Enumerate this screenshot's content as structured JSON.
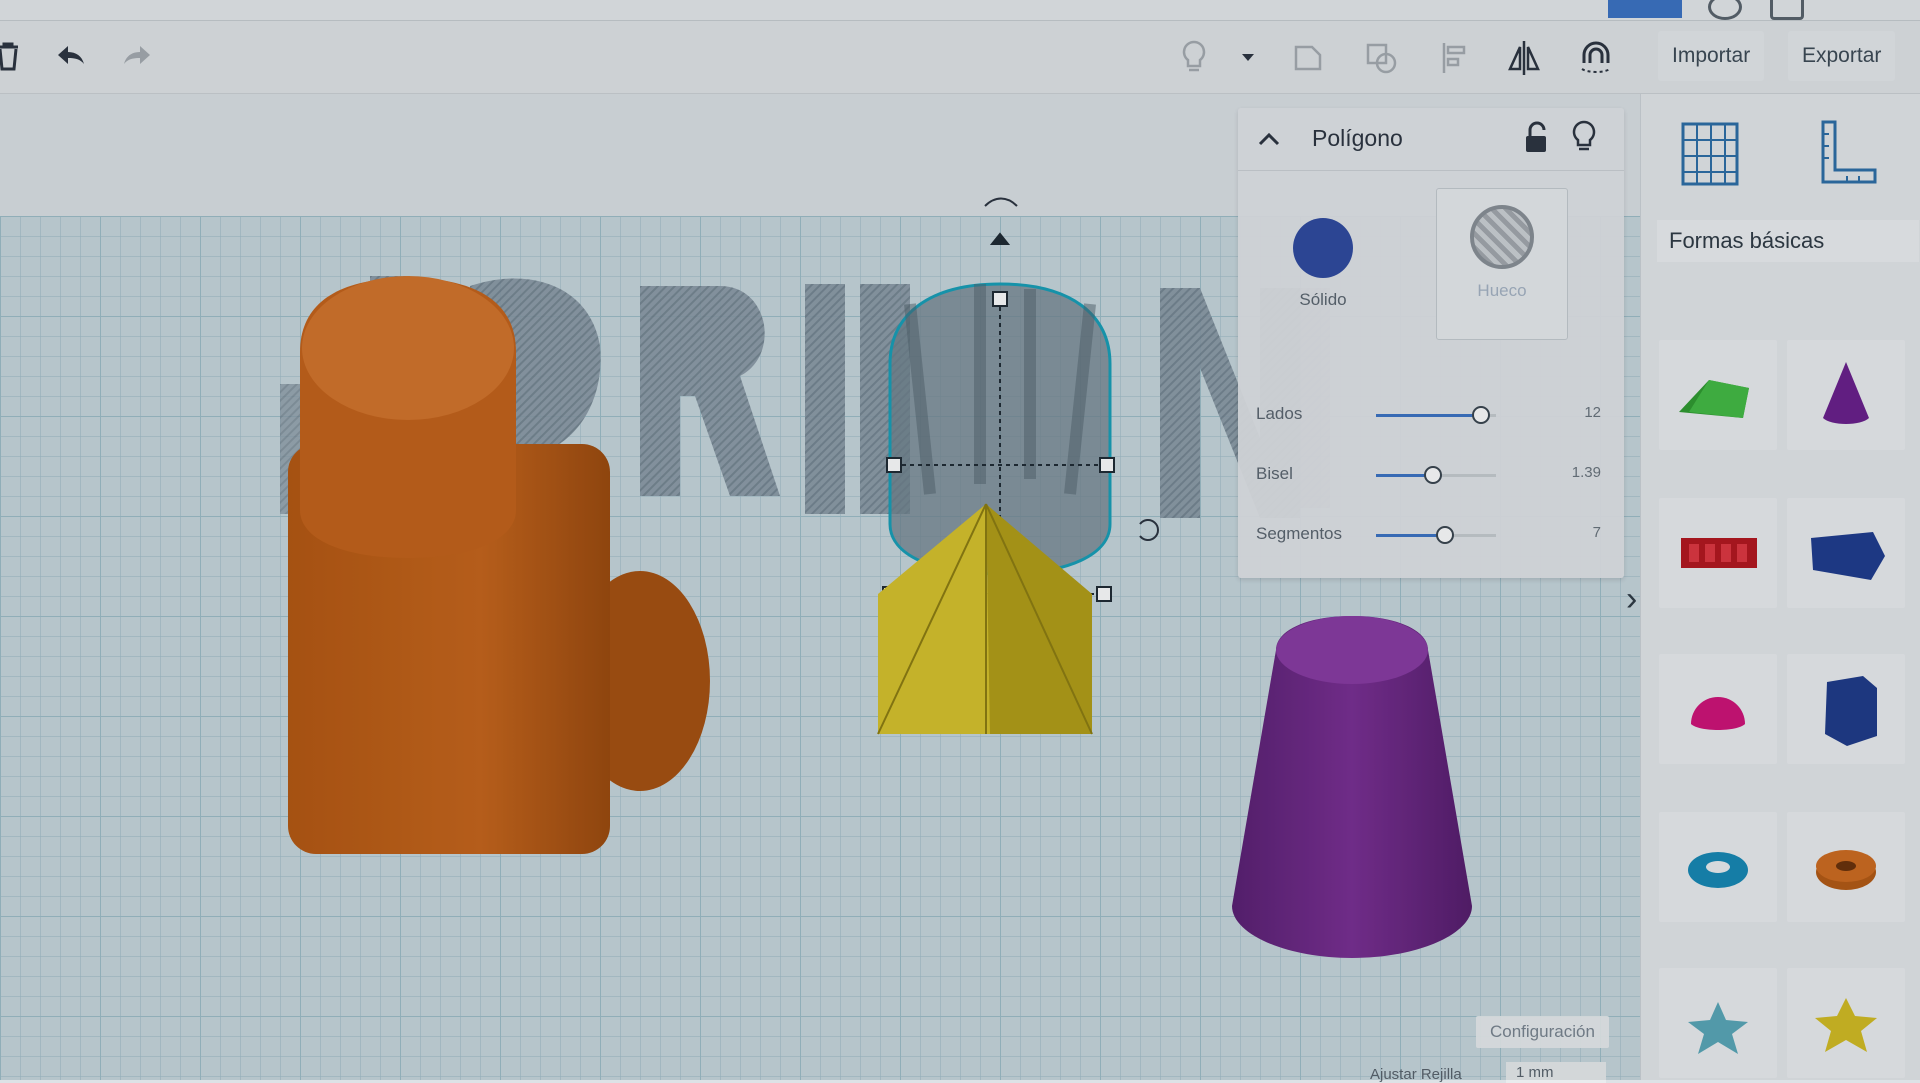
{
  "toolbar": {
    "import_label": "Importar",
    "export_label": "Exportar",
    "icons": [
      "delete-icon",
      "undo-icon",
      "redo-icon",
      "light-bulb-icon",
      "dropdown-caret-icon",
      "group-icon",
      "ungroup-icon",
      "align-icon",
      "mirror-icon",
      "magnet-icon"
    ]
  },
  "inspector": {
    "title": "Polígono",
    "solid_label": "Sólido",
    "hole_label": "Hueco",
    "solid_color": "#2f4aa0",
    "params": [
      {
        "label": "Lados",
        "value": "12",
        "fraction": 0.87
      },
      {
        "label": "Bisel",
        "value": "1.39",
        "fraction": 0.47
      },
      {
        "label": "Segmentos",
        "value": "7",
        "fraction": 0.57
      }
    ]
  },
  "library": {
    "title": "Formas básicas",
    "shapes": [
      "roof-shape-icon",
      "cone-shape-icon",
      "text-shape-icon",
      "wedge-shape-icon",
      "half-sphere-shape-icon",
      "polygon-shape-icon",
      "torus-shape-icon",
      "tube-shape-icon",
      "star-shape-icon",
      "yellow-star-shape-icon"
    ]
  },
  "workplane": {
    "settings_label": "Configuración",
    "snap_label": "Ajustar Rejilla",
    "snap_value": "1 mm",
    "text_object": "LORMAN"
  },
  "colors": {
    "accent": "#3b73c4",
    "orange_shape": "#c8651a",
    "yellow_shape": "#d4bd22",
    "purple_shape": "#6b2685",
    "hole_shape": "#7f8e98"
  }
}
